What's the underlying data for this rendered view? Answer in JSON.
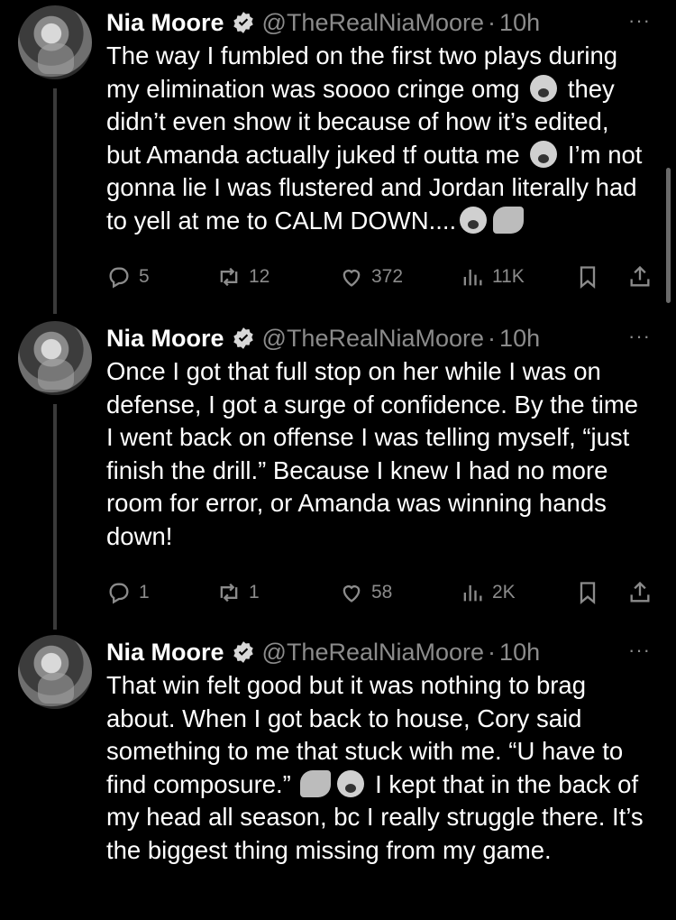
{
  "tweets": [
    {
      "name": "Nia Moore",
      "handle": "@TheRealNiaMoore",
      "separator": "·",
      "time": "10h",
      "more": "···",
      "text_parts": [
        "The way I fumbled on the first two plays during my elimination was soooo cringe omg ",
        " they didn’t even show it because of how it’s edited, but Amanda actually juked tf outta me ",
        " I’m not gonna lie I was flustered and Jordan literally had to yell at me to CALM DOWN....",
        ""
      ],
      "emojis": [
        "screaming-face-emoji",
        "screaming-face-emoji",
        "dizzy-face-emoji",
        "pinched-hand-emoji"
      ],
      "replies": "5",
      "reposts": "12",
      "likes": "372",
      "views": "11K"
    },
    {
      "name": "Nia Moore",
      "handle": "@TheRealNiaMoore",
      "separator": "·",
      "time": "10h",
      "more": "···",
      "text": "Once I got that full stop on her while I was on defense, I got a surge of confidence. By the time I went back on offense I was telling myself, “just finish the drill.” Because I knew I had no more room for error, or Amanda was winning hands down!",
      "replies": "1",
      "reposts": "1",
      "likes": "58",
      "views": "2K"
    },
    {
      "name": "Nia Moore",
      "handle": "@TheRealNiaMoore",
      "separator": "·",
      "time": "10h",
      "more": "···",
      "text_parts": [
        "That win felt good but it was nothing to brag about. When I got back to house, Cory said something to me that stuck with me. “U have to find composure.” ",
        " I kept that in the back of my head all season, bc I really struggle there. It’s the biggest thing missing from my game."
      ],
      "emojis": [
        "pointing-hand-emoji",
        "ok-hand-emoji"
      ]
    }
  ],
  "colors": {
    "background": "#000000",
    "text": "#ffffff",
    "secondary": "#8b8b8b",
    "thread_line": "#3a3a3a"
  }
}
